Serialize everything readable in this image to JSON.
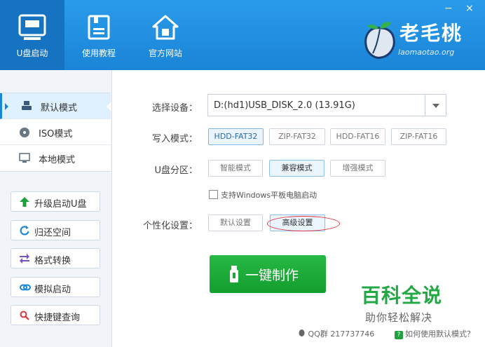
{
  "header": {
    "nav": [
      {
        "label": "U盘启动",
        "icon": "usb-drive-icon"
      },
      {
        "label": "使用教程",
        "icon": "document-icon"
      },
      {
        "label": "官方网站",
        "icon": "home-icon"
      }
    ],
    "minimize_glyph": "−",
    "close_glyph": "×",
    "logo_title": "老毛桃",
    "logo_sub": "laomaotao.org"
  },
  "sidebar": {
    "modes": [
      {
        "label": "默认模式",
        "icon": "usb-mode-icon",
        "active": true
      },
      {
        "label": "ISO模式",
        "icon": "disc-icon",
        "active": false
      },
      {
        "label": "本地模式",
        "icon": "monitor-icon",
        "active": false
      }
    ],
    "tools": [
      {
        "label": "升级启动U盘",
        "icon": "arrow-up-icon"
      },
      {
        "label": "归还空间",
        "icon": "refresh-icon"
      },
      {
        "label": "格式转换",
        "icon": "swap-icon"
      },
      {
        "label": "模拟启动",
        "icon": "link-icon"
      },
      {
        "label": "快捷键查询",
        "icon": "search-icon"
      }
    ]
  },
  "main": {
    "device_label": "选择设备：",
    "device_value": "D:(hd1)USB_DISK_2.0 (13.91G)",
    "write_label": "写入模式：",
    "write_options": [
      "HDD-FAT32",
      "ZIP-FAT32",
      "HDD-FAT16",
      "ZIP-FAT16"
    ],
    "write_selected": "HDD-FAT32",
    "partition_label": "U盘分区：",
    "partition_options": [
      "智能模式",
      "兼容模式",
      "增强模式"
    ],
    "partition_selected": "兼容模式",
    "tablet_label": "支持Windows平板电脑启动",
    "tablet_checked": false,
    "personal_label": "个性化设置：",
    "personal_options": [
      "默认设置",
      "高级设置"
    ],
    "personal_selected": "高级设置",
    "make_button": "一键制作"
  },
  "watermark": {
    "big": "百科全说",
    "small": "助你轻松解决"
  },
  "footer": {
    "qq": "QQ群 217737746",
    "help": "如何使用默认模式？"
  },
  "colors": {
    "header_blue": "#1b84d6",
    "accent_green": "#139e2e",
    "highlight_red": "#e0323a"
  }
}
